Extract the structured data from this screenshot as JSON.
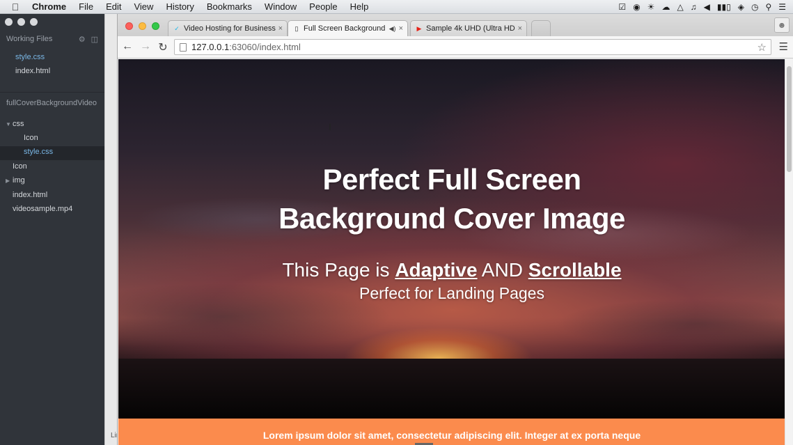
{
  "menubar": {
    "app": "Chrome",
    "items": [
      "File",
      "Edit",
      "View",
      "History",
      "Bookmarks",
      "Window",
      "People",
      "Help"
    ]
  },
  "ide": {
    "working_files_label": "Working Files",
    "working_files": [
      "style.css",
      "index.html"
    ],
    "project_name": "fullCoverBackgroundVideo",
    "tree": {
      "css_folder": "css",
      "css_icon": "Icon",
      "css_style": "style.css",
      "root_icon": "Icon",
      "img_folder": "img",
      "index": "index.html",
      "video": "videosample.mp4"
    },
    "status_fragment": "Lin"
  },
  "browser": {
    "tabs": [
      {
        "title": "Video Hosting for Business",
        "icon": "vimeo-icon"
      },
      {
        "title": "Full Screen Background",
        "icon": "page-icon"
      },
      {
        "title": "Sample 4k UHD (Ultra HD)",
        "icon": "youtube-icon"
      }
    ],
    "url_host": "127.0.0.1",
    "url_path": ":63060/index.html"
  },
  "page": {
    "title_line1": "Perfect Full Screen",
    "title_line2": "Background Cover Image",
    "sub_prefix": "This Page is ",
    "sub_adaptive": "Adaptive",
    "sub_and": " AND ",
    "sub_scrollable": "Scrollable",
    "sub_line2": "Perfect for Landing Pages",
    "footer_text": "Lorem ipsum dolor sit amet, consectetur adipiscing elit. Integer at ex porta neque"
  },
  "colors": {
    "footer_band": "#fb8b4d",
    "active_file": "#7ab7e6"
  }
}
